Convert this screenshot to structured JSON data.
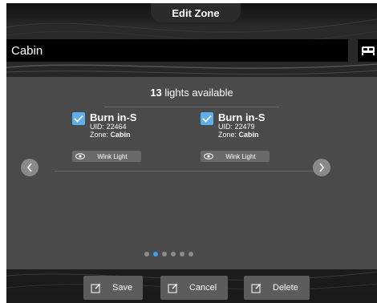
{
  "title": "Edit Zone",
  "zone_name": "Cabin",
  "lights": {
    "count": "13",
    "available_text": "lights available",
    "items": [
      {
        "name": "Burn in-S",
        "uid": "UID: 22464",
        "zone_label": "Zone: ",
        "zone": "Cabin",
        "wink_label": "Wink Light",
        "checked": true
      },
      {
        "name": "Burn in-S",
        "uid": "UID: 22479",
        "zone_label": "Zone: ",
        "zone": "Cabin",
        "wink_label": "Wink Light",
        "checked": true
      }
    ]
  },
  "pager": {
    "pages": 6,
    "active": 1
  },
  "buttons": {
    "save": "Save",
    "cancel": "Cancel",
    "delete": "Delete"
  },
  "colors": {
    "accent": "#3da1ea",
    "checkbox": "#5fb0ea",
    "panel": "#4a4a4a"
  }
}
